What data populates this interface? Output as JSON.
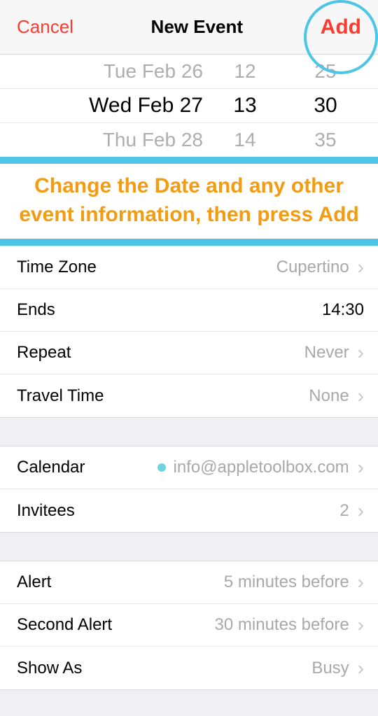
{
  "nav": {
    "cancel": "Cancel",
    "title": "New Event",
    "add": "Add"
  },
  "picker": {
    "rows": [
      {
        "date": "Tue Feb 26",
        "hh": "12",
        "mm": "25"
      },
      {
        "date": "Wed Feb 27",
        "hh": "13",
        "mm": "30"
      },
      {
        "date": "Thu Feb 28",
        "hh": "14",
        "mm": "35"
      }
    ]
  },
  "annotation": "Change the Date and any other event information, then press Add",
  "rows": {
    "timezone_label": "Time Zone",
    "timezone_value": "Cupertino",
    "ends_label": "Ends",
    "ends_value": "14:30",
    "repeat_label": "Repeat",
    "repeat_value": "Never",
    "travel_label": "Travel Time",
    "travel_value": "None",
    "calendar_label": "Calendar",
    "calendar_value": "info@appletoolbox.com",
    "invitees_label": "Invitees",
    "invitees_value": "2",
    "alert_label": "Alert",
    "alert_value": "5 minutes before",
    "alert2_label": "Second Alert",
    "alert2_value": "30 minutes before",
    "showas_label": "Show As",
    "showas_value": "Busy"
  }
}
